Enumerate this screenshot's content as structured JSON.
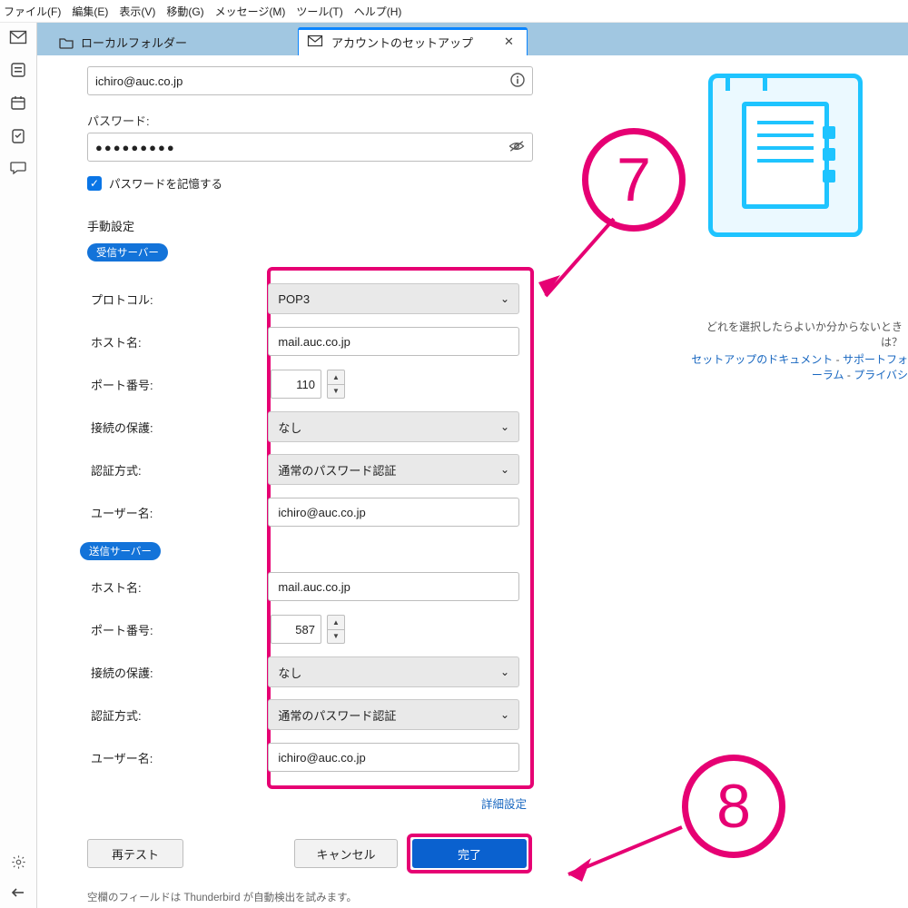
{
  "menu": {
    "file": "ファイル(F)",
    "edit": "編集(E)",
    "view": "表示(V)",
    "go": "移動(G)",
    "message": "メッセージ(M)",
    "tools": "ツール(T)",
    "help": "ヘルプ(H)"
  },
  "tabs": {
    "local": "ローカルフォルダー",
    "setup": "アカウントのセットアップ"
  },
  "email": {
    "value": "ichiro@auc.co.jp"
  },
  "password": {
    "label": "パスワード:",
    "value": "●●●●●●●●●",
    "remember": "パスワードを記憶する"
  },
  "manual": {
    "title": "手動設定"
  },
  "incoming": {
    "pill": "受信サーバー",
    "protocol_label": "プロトコル:",
    "protocol_value": "POP3",
    "host_label": "ホスト名:",
    "host_value": "mail.auc.co.jp",
    "port_label": "ポート番号:",
    "port_value": "110",
    "sec_label": "接続の保護:",
    "sec_value": "なし",
    "auth_label": "認証方式:",
    "auth_value": "通常のパスワード認証",
    "user_label": "ユーザー名:",
    "user_value": "ichiro@auc.co.jp"
  },
  "outgoing": {
    "pill": "送信サーバー",
    "host_label": "ホスト名:",
    "host_value": "mail.auc.co.jp",
    "port_label": "ポート番号:",
    "port_value": "587",
    "sec_label": "接続の保護:",
    "sec_value": "なし",
    "auth_label": "認証方式:",
    "auth_value": "通常のパスワード認証",
    "user_label": "ユーザー名:",
    "user_value": "ichiro@auc.co.jp"
  },
  "links": {
    "advanced": "詳細設定"
  },
  "buttons": {
    "retest": "再テスト",
    "cancel": "キャンセル",
    "done": "完了"
  },
  "footnote": "空欄のフィールドは Thunderbird が自動検出を試みます。",
  "help": {
    "q": "どれを選択したらよいか分からないときは？",
    "doc": "セットアップのドキュメント",
    "sep": " - ",
    "forum": "サポートフォーラム",
    "priv": "プライバシ"
  },
  "annot": {
    "seven": "⑦",
    "eight": "⑧"
  }
}
